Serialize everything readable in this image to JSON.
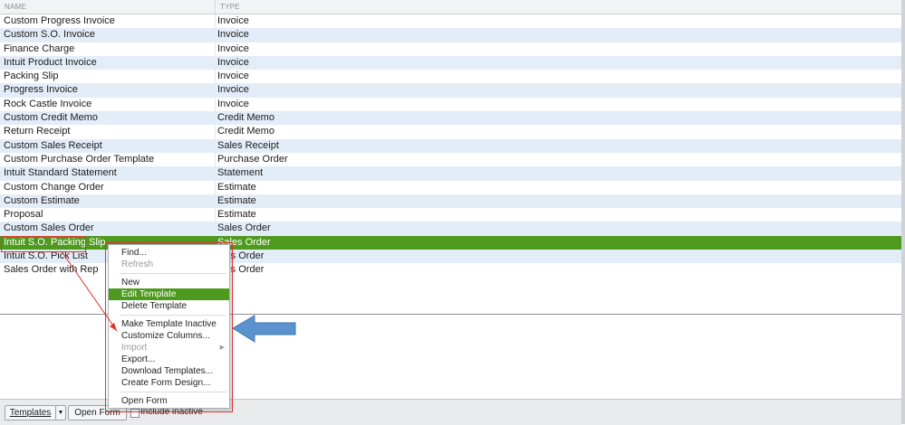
{
  "columns": {
    "name": "NAME",
    "type": "TYPE"
  },
  "rows": [
    {
      "name": "Custom Progress Invoice",
      "type": "Invoice"
    },
    {
      "name": "Custom S.O. Invoice",
      "type": "Invoice"
    },
    {
      "name": "Finance Charge",
      "type": "Invoice"
    },
    {
      "name": "Intuit Product Invoice",
      "type": "Invoice"
    },
    {
      "name": "Packing Slip",
      "type": "Invoice"
    },
    {
      "name": "Progress Invoice",
      "type": "Invoice"
    },
    {
      "name": "Rock Castle Invoice",
      "type": "Invoice"
    },
    {
      "name": "Custom Credit Memo",
      "type": "Credit Memo"
    },
    {
      "name": "Return Receipt",
      "type": "Credit Memo"
    },
    {
      "name": "Custom Sales Receipt",
      "type": "Sales Receipt"
    },
    {
      "name": "Custom Purchase Order Template",
      "type": "Purchase Order"
    },
    {
      "name": "Intuit Standard Statement",
      "type": "Statement"
    },
    {
      "name": "Custom Change Order",
      "type": "Estimate"
    },
    {
      "name": "Custom Estimate",
      "type": "Estimate"
    },
    {
      "name": "Proposal",
      "type": "Estimate"
    },
    {
      "name": "Custom Sales Order",
      "type": "Sales Order"
    },
    {
      "name": "Intuit S.O. Packing Slip",
      "type": "Sales Order"
    },
    {
      "name": "Intuit S.O. Pick List",
      "type": "ales Order"
    },
    {
      "name": "Sales Order with Rep",
      "type": "ales Order"
    }
  ],
  "context_menu": {
    "find": "Find...",
    "refresh": "Refresh",
    "new": "New",
    "edit_template": "Edit Template",
    "delete_template": "Delete Template",
    "make_inactive": "Make Template Inactive",
    "customize_columns": "Customize Columns...",
    "import": "Import",
    "export": "Export...",
    "download_templates": "Download Templates...",
    "create_form_design": "Create Form Design...",
    "open_form": "Open Form"
  },
  "bottom_bar": {
    "templates_label": "Templates",
    "open_form_label": "Open Form",
    "include_inactive_label": "Include inactive"
  },
  "colors": {
    "selection": "#4e9a1e",
    "alt_row": "#e3edf8",
    "annotation_red": "#e0322a",
    "annotation_arrow": "#5b93cf"
  }
}
